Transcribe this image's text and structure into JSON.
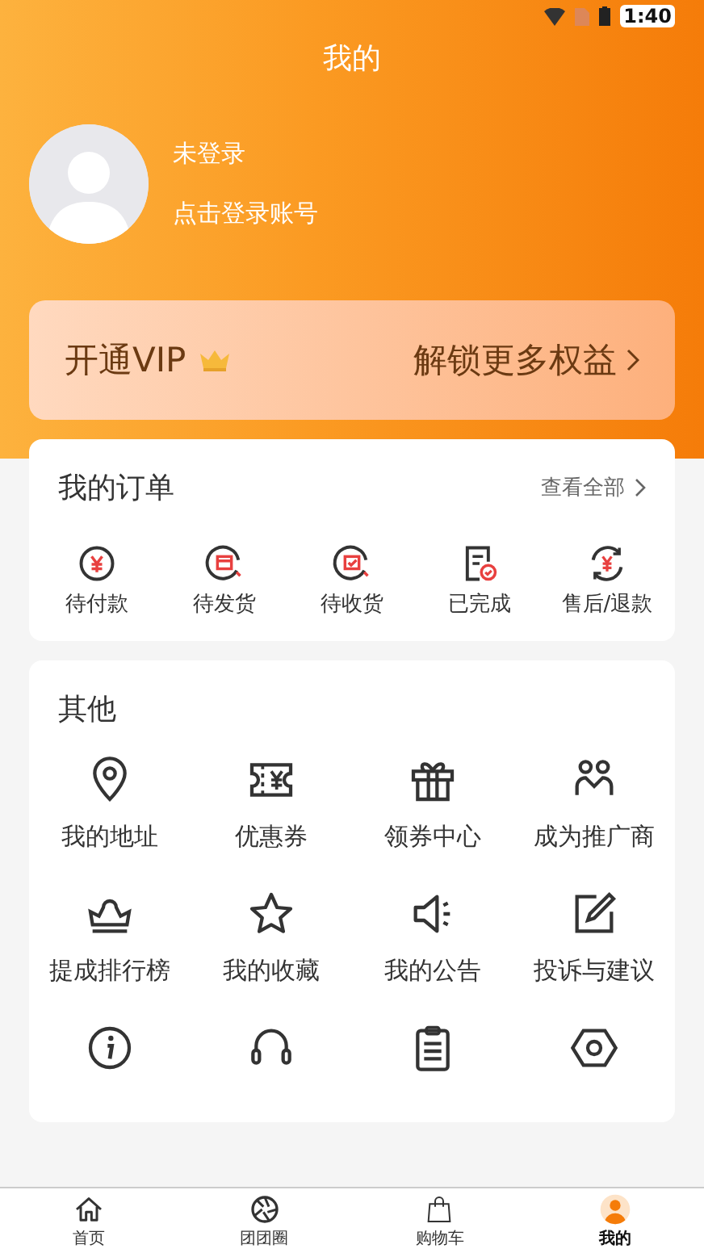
{
  "status_bar": {
    "time": "1:40"
  },
  "header": {
    "title": "我的"
  },
  "profile": {
    "name": "未登录",
    "hint": "点击登录账号"
  },
  "vip": {
    "label": "开通VIP",
    "link": "解锁更多权益"
  },
  "orders": {
    "title": "我的订单",
    "view_all": "查看全部",
    "items": [
      {
        "label": "待付款"
      },
      {
        "label": "待发货"
      },
      {
        "label": "待收货"
      },
      {
        "label": "已完成"
      },
      {
        "label": "售后/退款"
      }
    ]
  },
  "other": {
    "title": "其他",
    "items": [
      {
        "kind": "labeled",
        "label": "我的地址"
      },
      {
        "kind": "labeled",
        "label": "优惠券"
      },
      {
        "kind": "labeled",
        "label": "领券中心"
      },
      {
        "kind": "labeled",
        "label": "成为推广商"
      },
      {
        "kind": "labeled",
        "label": "提成排行榜"
      },
      {
        "kind": "labeled",
        "label": "我的收藏"
      },
      {
        "kind": "labeled",
        "label": "我的公告"
      },
      {
        "kind": "labeled",
        "label": "投诉与建议"
      },
      {
        "kind": "icon_only"
      },
      {
        "kind": "icon_only"
      },
      {
        "kind": "icon_only"
      },
      {
        "kind": "icon_only"
      }
    ]
  },
  "tab_bar": [
    {
      "label": "首页",
      "selected": false
    },
    {
      "label": "团团圈",
      "selected": false
    },
    {
      "label": "购物车",
      "selected": false
    },
    {
      "label": "我的",
      "selected": true
    }
  ]
}
